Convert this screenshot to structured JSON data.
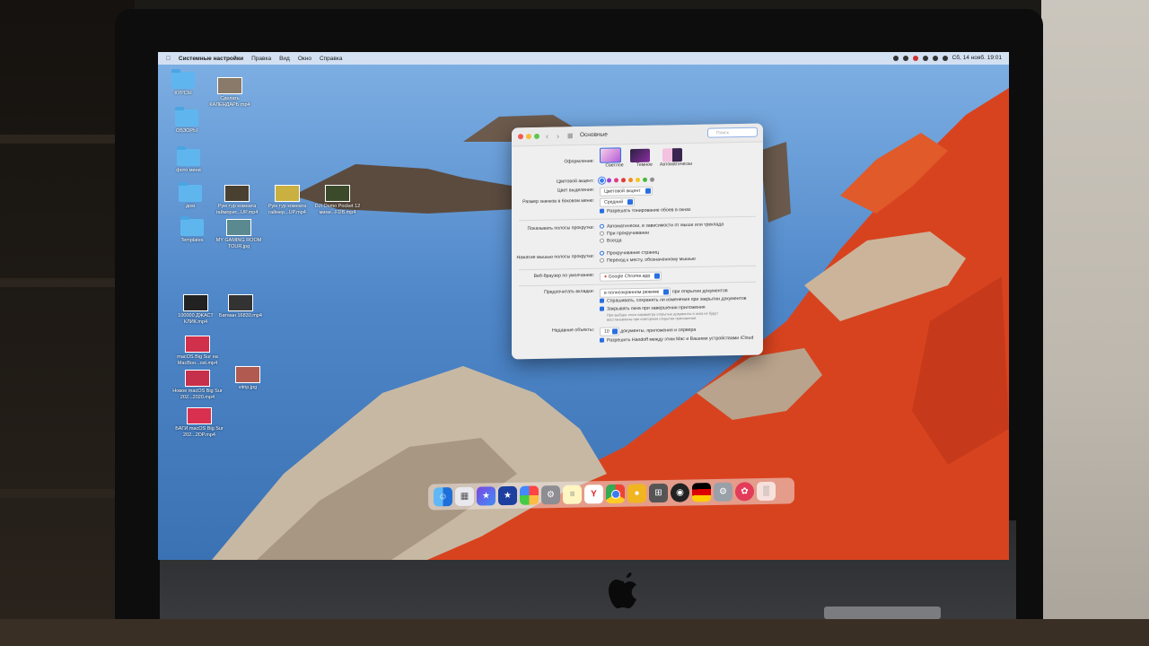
{
  "menubar": {
    "app_name": "Системные настройки",
    "items": [
      "Правка",
      "Вид",
      "Окно",
      "Справка"
    ],
    "clock": "Сб, 14 нояб. 19:01"
  },
  "desktop": {
    "icons": [
      {
        "label": "КУРСЫ",
        "type": "folder"
      },
      {
        "label": "Сделать КАЛЕНДАРЬ.mp4",
        "type": "video"
      },
      {
        "label": "ОБЗОРЫ",
        "type": "folder"
      },
      {
        "label": "фото мини",
        "type": "folder"
      },
      {
        "label": "дом",
        "type": "folder"
      },
      {
        "label": "Рум тур комната гайморит...UP.mp4",
        "type": "video"
      },
      {
        "label": "Рум тур комната гаймер...UP.mp4",
        "type": "video"
      },
      {
        "label": "DJI Osmo Pocket 12 мини...FDB.mp4",
        "type": "video"
      },
      {
        "label": "Templates",
        "type": "folder"
      },
      {
        "label": "MY GAMING ROOM TOUR.jpg",
        "type": "image"
      },
      {
        "label": "100000 ДЖАСТ КЛИК.mp4",
        "type": "video"
      },
      {
        "label": "Батман 16830.mp4",
        "type": "video"
      },
      {
        "label": "macOS Big Sur на MacBoo...ost.mp4",
        "type": "video"
      },
      {
        "label": "Новое macOS Big Sur 202...2020.mp4",
        "type": "video"
      },
      {
        "label": "vitrip.jpg",
        "type": "image"
      },
      {
        "label": "БАГИ macOS Big Sur 202...2DP.mp4",
        "type": "video"
      }
    ]
  },
  "prefs": {
    "title": "Основные",
    "search_placeholder": "Поиск",
    "appearance": {
      "label": "Оформление:",
      "options": [
        "Светлое",
        "Темное",
        "Автоматически"
      ]
    },
    "accent": {
      "label": "Цветовой акцент:"
    },
    "highlight": {
      "label": "Цвет выделения:",
      "value": "Цветовой акцент"
    },
    "sidebar_size": {
      "label": "Размер значков в боковом меню:",
      "value": "Средний"
    },
    "wallpaper_tinting": "Разрешать тонирование обоев в окнах",
    "scrollbars": {
      "label": "Показывать полосы прокрутки:",
      "options": [
        "Автоматически, в зависимости от мыши или трекпада",
        "При прокручивании",
        "Всегда"
      ]
    },
    "click_scroll": {
      "label": "Нажатие мышью полосы прокрутки:",
      "options": [
        "Прокручивание страниц",
        "Переход к месту, обозначенному мышью"
      ]
    },
    "browser": {
      "label": "Веб-браузер по умолчанию:",
      "value": "Google Chrome.app"
    },
    "tabs": {
      "label": "Предпочитать вкладки:",
      "value": "в полноэкранном режиме",
      "suffix": "при открытии документов"
    },
    "ask_keep": "Спрашивать, сохранять ли изменения при закрытии документов",
    "close_windows": "Закрывать окна при завершении приложения",
    "close_windows_hint": "При выборе этого параметра открытые документы и окна не будут восстановлены при повторном открытии приложения.",
    "recent": {
      "label": "Недавние объекты:",
      "value": "10",
      "suffix": "документы, приложения и сервера"
    },
    "handoff": "Разрешить Handoff между этим Mac и Вашими устройствами iCloud"
  },
  "colors": {
    "accent": "#2a6fe0",
    "accent_swatches": [
      "#3b7bf0",
      "#9b3fd6",
      "#e13d8a",
      "#e23b3b",
      "#f08a24",
      "#f2c81f",
      "#45b83c",
      "#8e8e93"
    ]
  },
  "dock": {
    "apps": [
      "finder-icon",
      "launchpad-icon",
      "imovie-icon",
      "star-icon",
      "photos-icon",
      "settings-icon",
      "notes-icon",
      "yandex-icon",
      "chrome-icon",
      "chrome-canary-icon",
      "calculator-icon",
      "obs-icon",
      "flag-icon",
      "disk-utility-icon",
      "fruit-icon",
      "trash-icon"
    ]
  }
}
